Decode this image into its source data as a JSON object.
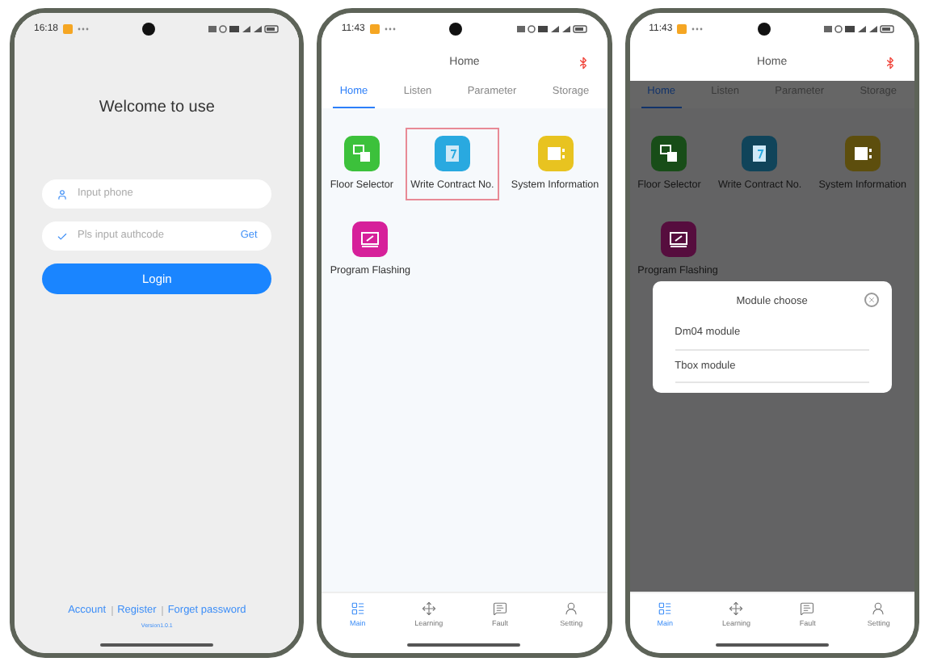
{
  "screens": [
    {
      "kind": "login",
      "status_time": "16:18",
      "title": "Welcome to use",
      "fields": [
        {
          "kind": "phone",
          "placeholder": "Input phone"
        },
        {
          "kind": "code",
          "placeholder": "Pls input authcode",
          "action": "Get"
        }
      ],
      "button": "Login",
      "links": [
        "Account",
        "Register",
        "Forget password"
      ],
      "version": "Version1.0.1"
    },
    {
      "kind": "home",
      "status_time": "11:43",
      "header": "Home",
      "tabs": [
        {
          "label": "Home",
          "selected": true
        },
        {
          "label": "Listen",
          "selected": false
        },
        {
          "label": "Parameter",
          "selected": false
        },
        {
          "label": "Storage",
          "selected": false
        }
      ],
      "apps": [
        {
          "label": "Floor Selector",
          "color": "#3cc13b",
          "highlighted": false
        },
        {
          "label": "Write Contract No.",
          "color": "#29a9e0",
          "highlighted": true
        },
        {
          "label": "System Information",
          "color": "#e8c320",
          "highlighted": false
        },
        {
          "label": "Program Flashing",
          "color": "#d6209a",
          "highlighted": false
        }
      ],
      "nav": [
        {
          "label": "Main",
          "selected": true
        },
        {
          "label": "Learning",
          "selected": false
        },
        {
          "label": "Fault",
          "selected": false
        },
        {
          "label": "Setting",
          "selected": false
        }
      ]
    },
    {
      "kind": "home",
      "status_time": "11:43",
      "header": "Home",
      "tabs": [
        {
          "label": "Home",
          "selected": true
        },
        {
          "label": "Listen",
          "selected": false
        },
        {
          "label": "Parameter",
          "selected": false
        },
        {
          "label": "Storage",
          "selected": false
        }
      ],
      "apps": [
        {
          "label": "Floor Selector",
          "color": "#184d18",
          "highlighted": false
        },
        {
          "label": "Write Contract No.",
          "color": "#10445a",
          "highlighted": false
        },
        {
          "label": "System Information",
          "color": "#5d4e0d",
          "highlighted": false
        },
        {
          "label": "Program Flashing",
          "color": "#560d3e",
          "highlighted": false
        }
      ],
      "dialog": {
        "title": "Module choose",
        "options": [
          "Dm04 module",
          "Tbox module"
        ]
      },
      "nav": [
        {
          "label": "Main",
          "selected": true
        },
        {
          "label": "Learning",
          "selected": false
        },
        {
          "label": "Fault",
          "selected": false
        },
        {
          "label": "Setting",
          "selected": false
        }
      ]
    }
  ]
}
